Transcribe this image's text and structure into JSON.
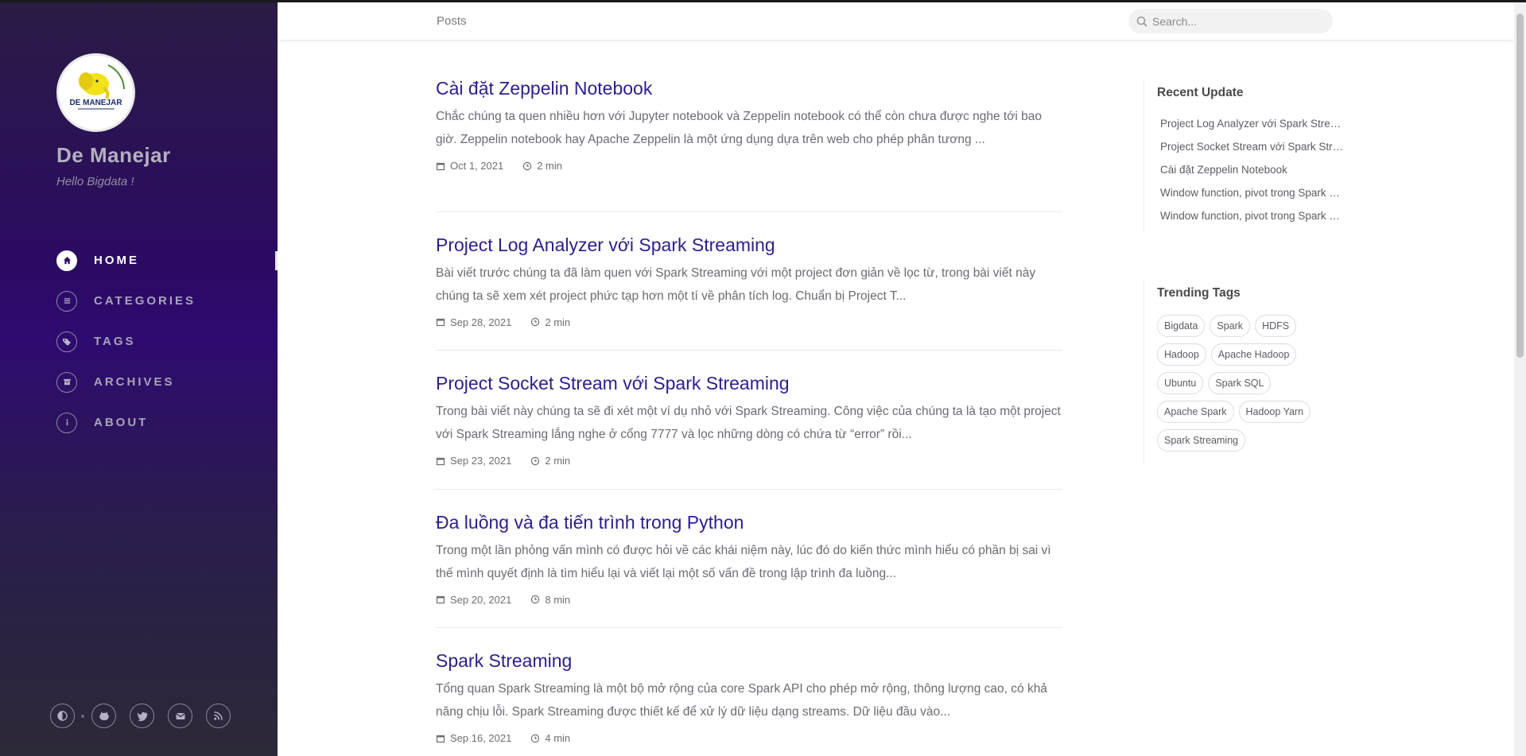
{
  "sidebar": {
    "logo_text": "DE MANEJAR",
    "title": "De Manejar",
    "subtitle": "Hello Bigdata !",
    "nav": [
      {
        "label": "HOME",
        "icon": "home-icon",
        "active": true
      },
      {
        "label": "CATEGORIES",
        "icon": "stream-icon",
        "active": false
      },
      {
        "label": "TAGS",
        "icon": "tags-icon",
        "active": false
      },
      {
        "label": "ARCHIVES",
        "icon": "archive-icon",
        "active": false
      },
      {
        "label": "ABOUT",
        "icon": "info-icon",
        "active": false
      }
    ],
    "social": [
      "theme-toggle-icon",
      "github-icon",
      "twitter-icon",
      "email-icon",
      "rss-icon"
    ]
  },
  "topbar": {
    "breadcrumb": "Posts",
    "search_placeholder": "Search..."
  },
  "posts": [
    {
      "title": "Cài đặt Zeppelin Notebook",
      "excerpt": "Chắc chúng ta quen nhiều hơn với Jupyter notebook và Zeppelin notebook có thể còn chưa được nghe tới bao giờ. Zeppelin notebook hay Apache Zeppelin là một ứng dụng dựa trên web cho phép phân tương ...",
      "date": "Oct 1, 2021",
      "read_time": "2 min"
    },
    {
      "title": "Project Log Analyzer với Spark Streaming",
      "excerpt": "Bài viết trước chúng ta đã làm quen với Spark Streaming với một project đơn giản về lọc từ, trong bài viết này chúng ta sẽ xem xét project phức tạp hơn một tí về phân tích log. Chuẩn bị Project T...",
      "date": "Sep 28, 2021",
      "read_time": "2 min"
    },
    {
      "title": "Project Socket Stream với Spark Streaming",
      "excerpt": "Trong bài viết này chúng ta sẽ đi xét một ví dụ nhỏ với Spark Streaming. Công việc của chúng ta là tạo một project với Spark Streaming lắng nghe ở cổng 7777 và lọc những dòng có chứa từ “error” rồi...",
      "date": "Sep 23, 2021",
      "read_time": "2 min"
    },
    {
      "title": "Đa luồng và đa tiến trình trong Python",
      "excerpt": "Trong một lần phỏng vấn mình có được hỏi về các khái niệm này, lúc đó do kiến thức mình hiểu có phần bị sai vì thế mình quyết định là tìm hiểu lại và viết lại một số vấn đề trong lập trình đa luồng...",
      "date": "Sep 20, 2021",
      "read_time": "8 min"
    },
    {
      "title": "Spark Streaming",
      "excerpt": "Tổng quan Spark Streaming là một bộ mở rộng của core Spark API cho phép mở rộng, thông lượng cao, có khả năng chịu lỗi. Spark Streaming được thiết kế để xử lý dữ liệu dạng streams. Dữ liệu đầu vào...",
      "date": "Sep 16, 2021",
      "read_time": "4 min"
    }
  ],
  "recent_update": {
    "heading": "Recent Update",
    "items": [
      "Project Log Analyzer với Spark Streaming",
      "Project Socket Stream với Spark Streaming",
      "Cài đặt Zeppelin Notebook",
      "Window function, pivot trong Spark SQL",
      "Window function, pivot trong Spark SQL"
    ]
  },
  "trending_tags": {
    "heading": "Trending Tags",
    "tags": [
      "Bigdata",
      "Spark",
      "HDFS",
      "Hadoop",
      "Apache Hadoop",
      "Ubuntu",
      "Spark SQL",
      "Apache Spark",
      "Hadoop Yarn",
      "Spark Streaming"
    ]
  },
  "colors": {
    "sidebar_accent": "#2e0b70",
    "post_title": "#2a1f8e"
  }
}
